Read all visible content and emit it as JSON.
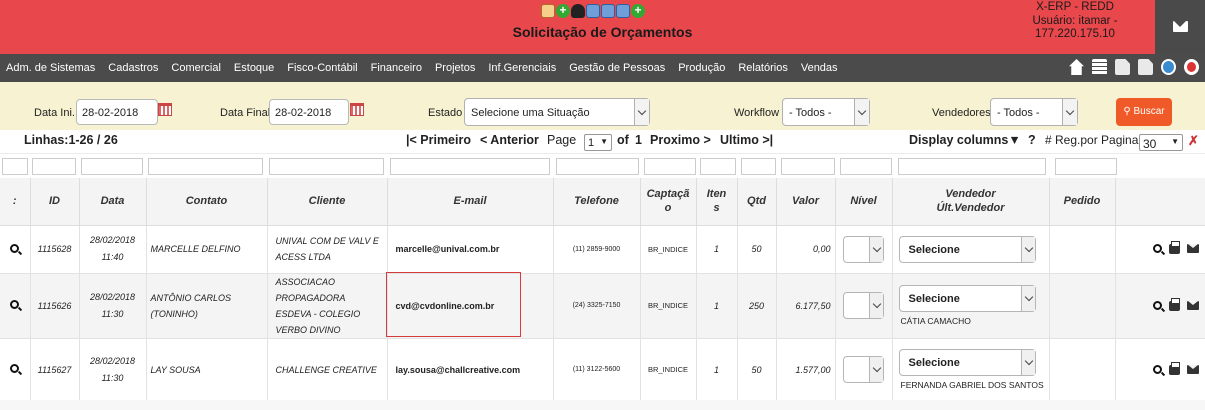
{
  "header": {
    "title": "Solicitação de Orçamentos",
    "user_line1": "X-ERP - REDD",
    "user_line2": "Usuário: itamar -",
    "user_line3": "177.220.175.10",
    "bg_color": "#e8474c"
  },
  "menu": {
    "items": [
      "Adm. de Sistemas",
      "Cadastros",
      "Comercial",
      "Estoque",
      "Fisco-Contábil",
      "Financeiro",
      "Projetos",
      "Inf.Gerenciais",
      "Gestão de Pessoas",
      "Produção",
      "Relatórios",
      "Vendas"
    ]
  },
  "filters": {
    "data_ini_label": "Data Ini.",
    "data_ini_value": "28-02-2018",
    "data_final_label": "Data Final",
    "data_final_value": "28-02-2018",
    "estado_label": "Estado",
    "estado_value": "Selecione uma Situação",
    "workflow_label": "Workflow",
    "workflow_value": "- Todos -",
    "vendedores_label": "Vendedores",
    "vendedores_value": "- Todos -",
    "buscar_label": "Buscar",
    "buscar_color": "#f05a28"
  },
  "pager": {
    "lines": "Linhas:1-26 / 26",
    "first": "|< Primeiro",
    "prev": "< Anterior",
    "page_label": "Page",
    "page_value": "1",
    "of_label": "of",
    "total_pages": "1",
    "next": "Proximo >",
    "last": "Ultimo >|",
    "display_columns": "Display columns▼",
    "help": "?",
    "reg_label": "# Reg.por Pagina",
    "reg_value": "30"
  },
  "columns": {
    "c0": ":",
    "c1": "ID",
    "c2": "Data",
    "c3": "Contato",
    "c4": "Cliente",
    "c5": "E-mail",
    "c6": "Telefone",
    "c7a": "Captaçã",
    "c7b": "o",
    "c8a": "Iten",
    "c8b": "s",
    "c9": "Qtd",
    "c10": "Valor",
    "c11": "Nível",
    "c12a": "Vendedor",
    "c12b": "Últ.Vendedor",
    "c13": "Pedido"
  },
  "rows": [
    {
      "id": "1115628",
      "date": "28/02/2018",
      "time": "11:40",
      "contato": "MARCELLE DELFINO",
      "cliente": "UNIVAL COM DE VALV E ACESS LTDA",
      "email": "marcelle@unival.com.br",
      "telefone": "(11) 2859-9000",
      "captacao": "BR_INDICE",
      "itens": "1",
      "qtd": "50",
      "valor": "0,00",
      "vendedor_select": "Selecione",
      "ult_vendedor": ""
    },
    {
      "id": "1115626",
      "date": "28/02/2018",
      "time": "11:30",
      "contato": "ANTÔNIO CARLOS (TONINHO)",
      "cliente": "ASSOCIACAO PROPAGADORA ESDEVA - COLEGIO VERBO DIVINO",
      "email": "cvd@cvdonline.com.br",
      "telefone": "(24) 3325-7150",
      "captacao": "BR_INDICE",
      "itens": "1",
      "qtd": "250",
      "valor": "6.177,50",
      "vendedor_select": "Selecione",
      "ult_vendedor": "CÁTIA CAMACHO"
    },
    {
      "id": "1115627",
      "date": "28/02/2018",
      "time": "11:30",
      "contato": "LAY SOUSA",
      "cliente": "CHALLENGE CREATIVE",
      "email": "lay.sousa@challcreative.com",
      "telefone": "(11) 3122-5600",
      "captacao": "BR_INDICE",
      "itens": "1",
      "qtd": "50",
      "valor": "1.577,00",
      "vendedor_select": "Selecione",
      "ult_vendedor": "FERNANDA GABRIEL DOS SANTOS"
    }
  ]
}
